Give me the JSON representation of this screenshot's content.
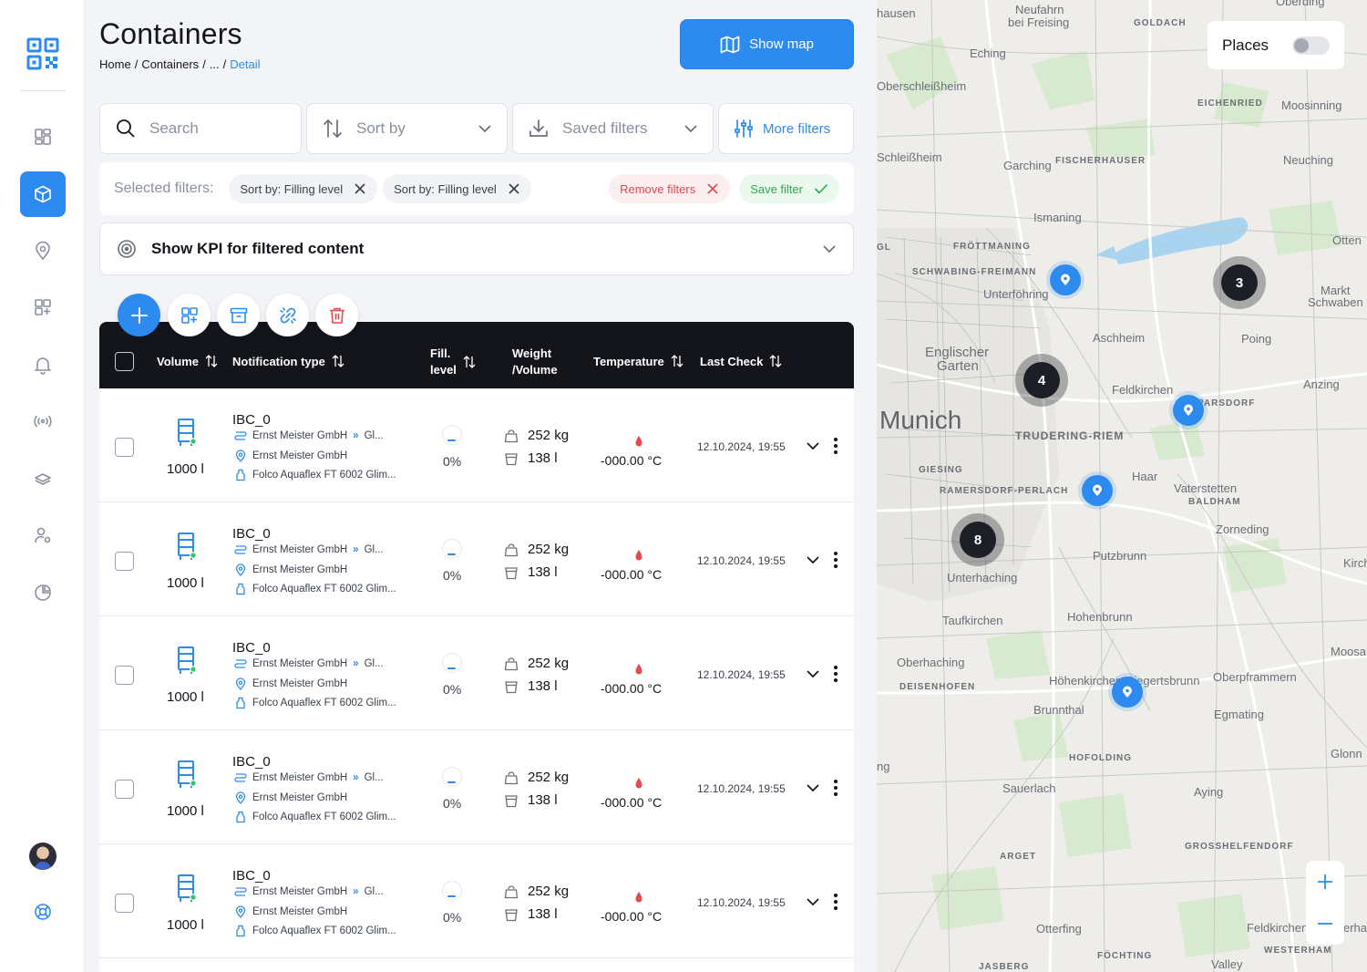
{
  "page": {
    "title": "Containers"
  },
  "breadcrumb": {
    "home": "Home",
    "sep1": "/",
    "containers": "Containers",
    "sep2": "/",
    "ellipsis": "...",
    "sep3": "/",
    "current": "Detail"
  },
  "header": {
    "show_map_label": "Show map"
  },
  "filters": {
    "search_placeholder": "Search",
    "sort_label": "Sort by",
    "saved_label": "Saved filters",
    "more_label": "More filters"
  },
  "selected_filters": {
    "label": "Selected filters:",
    "chips": [
      "Sort by: Filling level",
      "Sort by: Filling level"
    ],
    "remove_label": "Remove filters",
    "save_label": "Save filter"
  },
  "kpi": {
    "label": "Show KPI for filtered content"
  },
  "table": {
    "headers": {
      "volume": "Volume",
      "notification": "Notification type",
      "fill_line1": "Fill.",
      "fill_line2": "level",
      "weight_line1": "Weight",
      "weight_line2": "/Volume",
      "temperature": "Temperature",
      "last_check": "Last Check"
    },
    "rows": [
      {
        "name": "IBC_0",
        "volume": "1000 l",
        "company": "Ernst Meister GmbH",
        "route_to": "Gl...",
        "location": "Ernst Meister GmbH",
        "product": "Folco Aquaflex FT 6002 Glim...",
        "fill": "0%",
        "weight": "252 kg",
        "vol": "138 l",
        "temp": "-000.00 °C",
        "date": "12.10.2024, 19:55"
      },
      {
        "name": "IBC_0",
        "volume": "1000 l",
        "company": "Ernst Meister GmbH",
        "route_to": "Gl...",
        "location": "Ernst Meister GmbH",
        "product": "Folco Aquaflex FT 6002 Glim...",
        "fill": "0%",
        "weight": "252 kg",
        "vol": "138 l",
        "temp": "-000.00 °C",
        "date": "12.10.2024, 19:55"
      },
      {
        "name": "IBC_0",
        "volume": "1000 l",
        "company": "Ernst Meister GmbH",
        "route_to": "Gl...",
        "location": "Ernst Meister GmbH",
        "product": "Folco Aquaflex FT 6002 Glim...",
        "fill": "0%",
        "weight": "252 kg",
        "vol": "138 l",
        "temp": "-000.00 °C",
        "date": "12.10.2024, 19:55"
      },
      {
        "name": "IBC_0",
        "volume": "1000 l",
        "company": "Ernst Meister GmbH",
        "route_to": "Gl...",
        "location": "Ernst Meister GmbH",
        "product": "Folco Aquaflex FT 6002 Glim...",
        "fill": "0%",
        "weight": "252 kg",
        "vol": "138 l",
        "temp": "-000.00 °C",
        "date": "12.10.2024, 19:55"
      },
      {
        "name": "IBC_0",
        "volume": "1000 l",
        "company": "Ernst Meister GmbH",
        "route_to": "Gl...",
        "location": "Ernst Meister GmbH",
        "product": "Folco Aquaflex FT 6002 Glim...",
        "fill": "0%",
        "weight": "252 kg",
        "vol": "138 l",
        "temp": "-000.00 °C",
        "date": "12.10.2024, 19:55"
      }
    ]
  },
  "map": {
    "places_label": "Places",
    "labels": {
      "unterfohring": "Unterföhring",
      "aschheim": "Aschheim",
      "englischer": "Englischer",
      "garten": "Garten",
      "munich": "Munich",
      "feldkirchen": "Feldkirchen",
      "truderingriem": "TRUDERING-RIEM",
      "haar": "Haar",
      "vaterstetten": "Vaterstetten",
      "baldham": "BALDHAM",
      "giesing": "GIESING",
      "ramersdorf": "RAMERSDORF-PERLACH",
      "zorneding": "Zorneding",
      "putzbrunn": "Putzbrunn",
      "unterhaching": "Unterhaching",
      "taufkirchen": "Taufkirchen",
      "hohenbrunn": "Hohenbrunn",
      "oberhaching": "Oberhaching",
      "deisenhofen": "DEISENHOFEN",
      "hohenkirchen": "Höhenkirchen-Siegertsbrunn",
      "brunnthal": "Brunnthal",
      "oberpframmern": "Oberpframmern",
      "egmating": "Egmating",
      "hofolding": "HOFOLDING",
      "sauerlach": "Sauerlach",
      "aying": "Aying",
      "grosshelfendorf": "GROSSHELFENDORF",
      "arget": "ARGET",
      "otterfing": "Otterfing",
      "fochting": "FÖCHTING",
      "valley": "Valley",
      "jasberg": "JASBERG",
      "westerham": "WESTERHAM",
      "feldkirchenw": "Feldkirchen",
      "echingl": "Eching",
      "neufahrn": "Neufahrn",
      "beifreising": "bei Freising",
      "goldach": "GOLDACH",
      "eichenried": "EICHENRIED",
      "moosinning": "Moosinning",
      "garching": "Garching",
      "fischerhauser": "FISCHERHAUSER",
      "neuching": "Neuching",
      "ismaning": "Ismaning",
      "frottmaning": "FRÖTTMANING",
      "schwabing": "SCHWABING-FREIMANN",
      "poing": "Poing",
      "markt": "Markt",
      "schwaben": "Schwaben",
      "anzing": "Anzing",
      "parsdorf": "PARSDORF",
      "oberschleissheim": "Oberschleißheim",
      "schleissheim": "Schleißheim",
      "hausen": "hausen",
      "gl": "GL",
      "ottenl": "Otten",
      "kirch": "Kirch",
      "moos": "Moosa",
      "glonn": "Glonn",
      "ng": "ng",
      "uberling": "Oberding",
      "erhar": "erhar"
    },
    "clusters": [
      "3",
      "4",
      "8"
    ]
  }
}
